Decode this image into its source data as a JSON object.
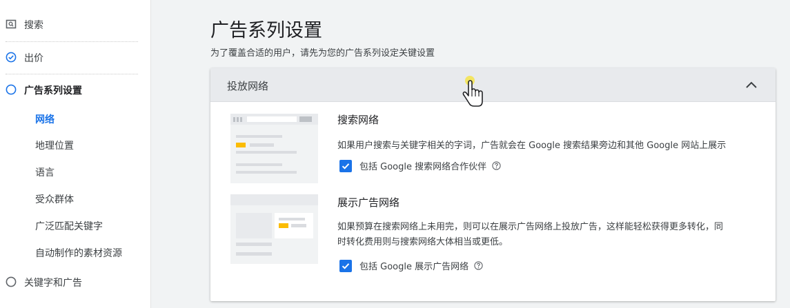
{
  "sidebar": {
    "steps": [
      {
        "label": "搜索",
        "icon": "search-icon"
      },
      {
        "label": "出价",
        "icon": "check-circle-icon"
      },
      {
        "label": "广告系列设置",
        "icon": "circle-icon"
      },
      {
        "label": "关键字和广告",
        "icon": "circle-icon"
      }
    ],
    "subitems": [
      {
        "label": "网络",
        "active": true
      },
      {
        "label": "地理位置"
      },
      {
        "label": "语言"
      },
      {
        "label": "受众群体"
      },
      {
        "label": "广泛匹配关键字"
      },
      {
        "label": "自动制作的素材资源"
      }
    ]
  },
  "main": {
    "title": "广告系列设置",
    "subtitle": "为了覆盖合适的用户，请先为您的广告系列设定关键设置"
  },
  "card": {
    "header": "投放网络",
    "search_network": {
      "title": "搜索网络",
      "desc": "如果用户搜索与关键字相关的字词，广告就会在 Google 搜索结果旁边和其他 Google 网站上展示",
      "checkbox_label": "包括 Google 搜索网络合作伙伴",
      "checked": true
    },
    "display_network": {
      "title": "展示广告网络",
      "desc_line1": "如果预算在搜索网络上未用完，则可以在展示广告网络上投放广告，这样能轻松获得更多转化，同",
      "desc_line2": "时转化费用则与搜索网络大体相当或更低。",
      "checkbox_label": "包括 Google 展示广告网络",
      "checked": true
    }
  },
  "colors": {
    "accent": "#1a73e8",
    "illustration_yellow": "#fbbc04",
    "header_bg": "#e8eaed"
  }
}
